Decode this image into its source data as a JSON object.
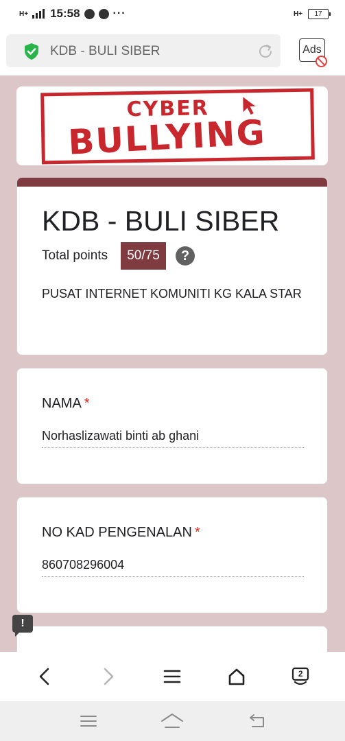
{
  "status_bar": {
    "time": "15:58",
    "network_left": "H+",
    "network_right": "H+",
    "battery": "17",
    "more": "···"
  },
  "browser": {
    "url_title": "KDB - BULI SIBER",
    "ads_label": "Ads",
    "tab_count": "2"
  },
  "banner": {
    "line1": "CYBER",
    "line2": "BULLYING"
  },
  "form": {
    "title": "KDB - BULI SIBER",
    "points_label": "Total points",
    "points_value": "50/75",
    "help_symbol": "?",
    "description": "PUSAT INTERNET KOMUNITI KG KALA STAR"
  },
  "questions": [
    {
      "title": "NAMA",
      "required_mark": "*",
      "answer": "Norhaslizawati binti ab ghani"
    },
    {
      "title": "NO KAD PENGENALAN",
      "required_mark": "*",
      "answer": "860708296004"
    }
  ],
  "feedback_symbol": "!",
  "colors": {
    "theme": "#7f3b40",
    "background": "#dcc6c8",
    "required": "#d93025",
    "stamp": "#c8272d"
  }
}
